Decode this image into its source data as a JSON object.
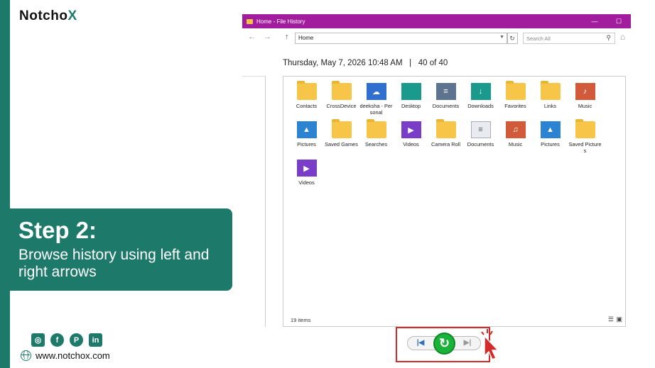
{
  "brand": {
    "logo_text": "Notcho",
    "logo_x": "X",
    "website": "www.notchox.com",
    "accent": "#1d7a6a"
  },
  "step": {
    "title": "Step 2:",
    "description": "Browse history using left and right arrows"
  },
  "social_icons": [
    "instagram-icon",
    "facebook-icon",
    "pinterest-icon",
    "linkedin-icon"
  ],
  "window": {
    "title": "Home - File History",
    "title_bar_color": "#a21c9e",
    "address": "Home",
    "search_placeholder": "Search All",
    "date_line": "Thursday, May 7, 2026 10:48 AM",
    "separator": "|",
    "position": "40 of 40",
    "status": "19 items"
  },
  "items": [
    {
      "label": "Contacts",
      "icon": "folder"
    },
    {
      "label": "CrossDevice",
      "icon": "folder"
    },
    {
      "label": "deeksha - Personal",
      "icon": "onedrive"
    },
    {
      "label": "Desktop",
      "icon": "desktop"
    },
    {
      "label": "Documents",
      "icon": "documents"
    },
    {
      "label": "Downloads",
      "icon": "downloads"
    },
    {
      "label": "Favorites",
      "icon": "folder"
    },
    {
      "label": "Links",
      "icon": "folder"
    },
    {
      "label": "Music",
      "icon": "music-folder"
    },
    {
      "label": "Pictures",
      "icon": "pictures"
    },
    {
      "label": "Saved Games",
      "icon": "folder"
    },
    {
      "label": "Searches",
      "icon": "folder"
    },
    {
      "label": "Videos",
      "icon": "videos"
    },
    {
      "label": "Camera Roll",
      "icon": "file"
    },
    {
      "label": "Documents",
      "icon": "document-file"
    },
    {
      "label": "Music",
      "icon": "music-file"
    },
    {
      "label": "Pictures",
      "icon": "picture-file"
    },
    {
      "label": "Saved Pictures",
      "icon": "file"
    },
    {
      "label": "Videos",
      "icon": "video-file"
    }
  ],
  "controls": {
    "previous": "previous-version",
    "restore": "restore",
    "next": "next-version"
  }
}
